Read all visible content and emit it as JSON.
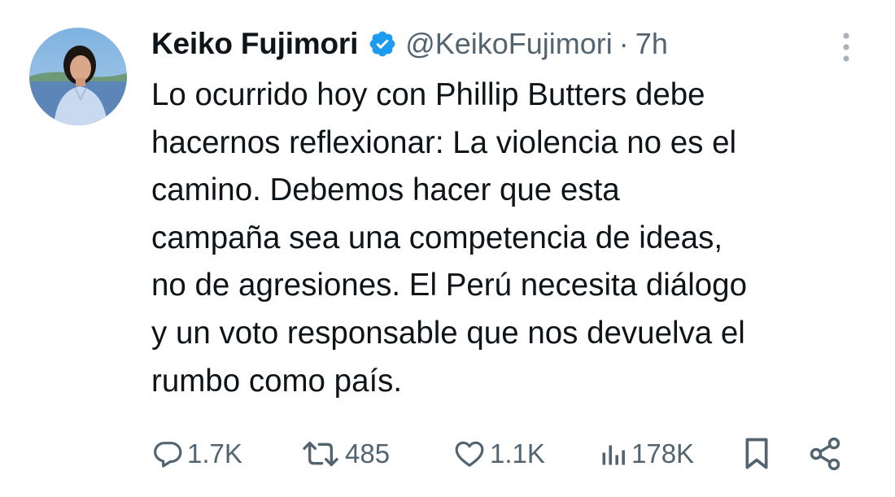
{
  "author": {
    "display_name": "Keiko Fujimori",
    "handle": "@KeikoFujimori",
    "separator": "·",
    "time": "7h",
    "verified": true
  },
  "tweet": {
    "text": "Lo ocurrido hoy con Phillip Butters debe\nhacernos reflexionar: La violencia no es el\ncamino. Debemos hacer que esta\ncampaña sea una competencia de ideas,\nno de agresiones. El Perú necesita diálogo\ny un voto responsable que nos devuelva el\nrumbo como país."
  },
  "actions": {
    "replies": "1.7K",
    "retweets": "485",
    "likes": "1.1K",
    "views": "178K"
  },
  "icons": {
    "reply": "reply-icon",
    "retweet": "retweet-icon",
    "like": "heart-icon",
    "views": "views-chart-icon",
    "bookmark": "bookmark-icon",
    "share": "share-icon",
    "more": "more-vertical-icon",
    "verified": "verified-badge-icon"
  },
  "colors": {
    "text": "#0f1419",
    "secondary": "#536471",
    "verified": "#1d9bf0",
    "background": "#ffffff"
  }
}
